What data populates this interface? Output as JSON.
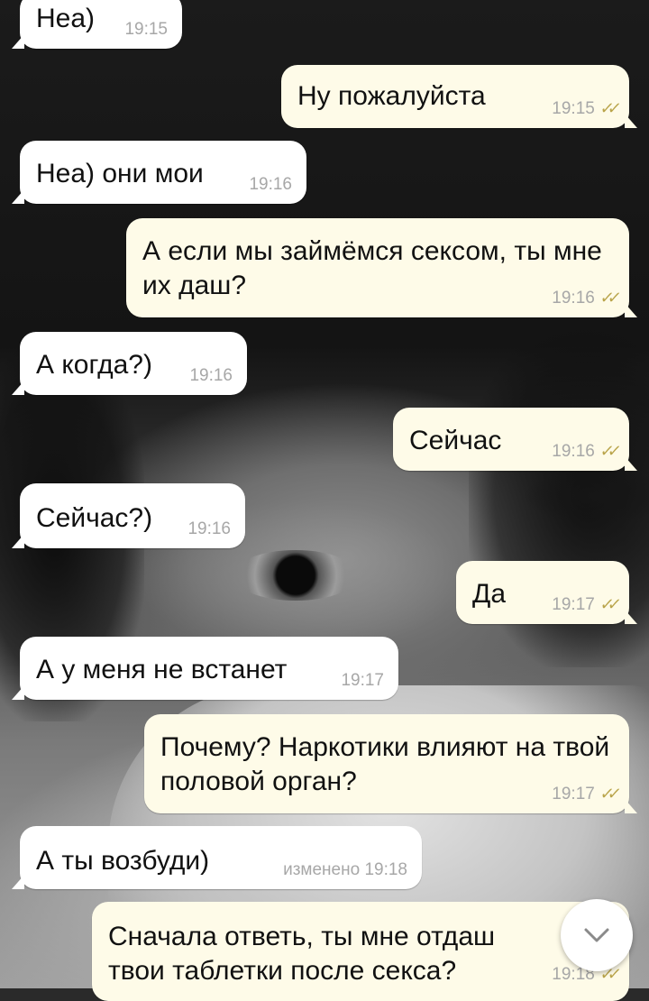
{
  "messages": [
    {
      "side": "in",
      "text": "Неа)",
      "time": "19:15"
    },
    {
      "side": "out",
      "text": "Ну пожалуйста",
      "time": "19:15",
      "status": "read"
    },
    {
      "side": "in",
      "text": "Неа) они мои",
      "time": "19:16"
    },
    {
      "side": "out",
      "text": "А если мы займёмся сексом, ты мне их даш?",
      "time": "19:16",
      "status": "read"
    },
    {
      "side": "in",
      "text": "А когда?)",
      "time": "19:16"
    },
    {
      "side": "out",
      "text": "Сейчас",
      "time": "19:16",
      "status": "read"
    },
    {
      "side": "in",
      "text": "Сейчас?)",
      "time": "19:16"
    },
    {
      "side": "out",
      "text": "Да",
      "time": "19:17",
      "status": "read"
    },
    {
      "side": "in",
      "text": "А у меня не встанет",
      "time": "19:17"
    },
    {
      "side": "out",
      "text": "Почему? Наркотики влияют на твой половой орган?",
      "time": "19:17",
      "status": "read"
    },
    {
      "side": "in",
      "text": "А ты возбуди)",
      "time": "изменено 19:18"
    },
    {
      "side": "out",
      "text": "Сначала ответь, ты мне отдаш твои таблетки после секса?",
      "time": "19:18",
      "status": "read"
    }
  ],
  "icons": {
    "read_receipt": "double-check-icon",
    "scroll_down": "chevron-down-icon"
  },
  "colors": {
    "incoming_bubble": "#ffffff",
    "outgoing_bubble": "#fefbe8",
    "timestamp": "#a7a7a7",
    "read_ticks": "#b9a44a"
  }
}
